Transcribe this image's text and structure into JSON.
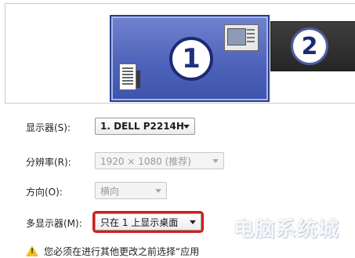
{
  "preview": {
    "monitor1_number": "1",
    "monitor2_number": "2"
  },
  "form": {
    "display": {
      "label": "显示器(S):",
      "value": "1. DELL P2214H"
    },
    "resolution": {
      "label": "分辨率(R):",
      "value": "1920 × 1080 (推荐)"
    },
    "orientation": {
      "label": "方向(O):",
      "value": "横向"
    },
    "multiple_displays": {
      "label": "多显示器(M):",
      "value": "只在 1 上显示桌面"
    }
  },
  "warning": {
    "icon": "warning-triangle-icon",
    "text": "您必须在进行其他更改之前选择“应用"
  },
  "watermark": {
    "text": "电脑系统城"
  },
  "colors": {
    "highlight": "#d11e1e",
    "monitor1": "#4c61b8",
    "monitor2": "#262626"
  }
}
